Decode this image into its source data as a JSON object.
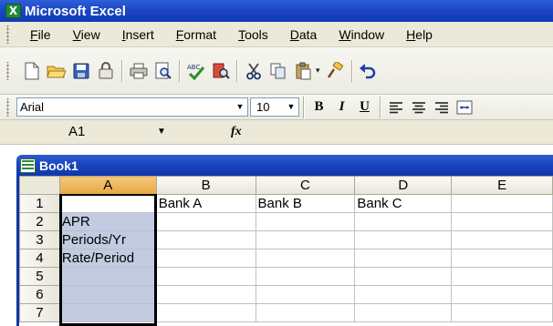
{
  "app": {
    "title": "Microsoft Excel"
  },
  "menu": [
    "File",
    "View",
    "Insert",
    "Format",
    "Tools",
    "Data",
    "Window",
    "Help"
  ],
  "formatting": {
    "font": "Arial",
    "size": "10",
    "bold": "B",
    "italic": "I",
    "underline": "U"
  },
  "formula_bar": {
    "name_box": "A1",
    "fx": "fx",
    "content": ""
  },
  "workbook": {
    "title": "Book1",
    "columns": [
      "A",
      "B",
      "C",
      "D",
      "E"
    ],
    "rows": [
      {
        "num": "1",
        "cells": [
          "",
          "Bank A",
          "Bank B",
          "Bank C",
          ""
        ]
      },
      {
        "num": "2",
        "cells": [
          "APR",
          "",
          "",
          "",
          ""
        ]
      },
      {
        "num": "3",
        "cells": [
          "Periods/Yr",
          "",
          "",
          "",
          ""
        ]
      },
      {
        "num": "4",
        "cells": [
          "Rate/Period",
          "",
          "",
          "",
          ""
        ]
      },
      {
        "num": "5",
        "cells": [
          "",
          "",
          "",
          "",
          ""
        ]
      },
      {
        "num": "6",
        "cells": [
          "",
          "",
          "",
          "",
          ""
        ]
      },
      {
        "num": "7",
        "cells": [
          "",
          "",
          "",
          "",
          ""
        ]
      }
    ]
  },
  "colors": {
    "title_bar": "#1c47c4",
    "selection": "#c1cbe2",
    "selected_header": "#e7a841"
  }
}
